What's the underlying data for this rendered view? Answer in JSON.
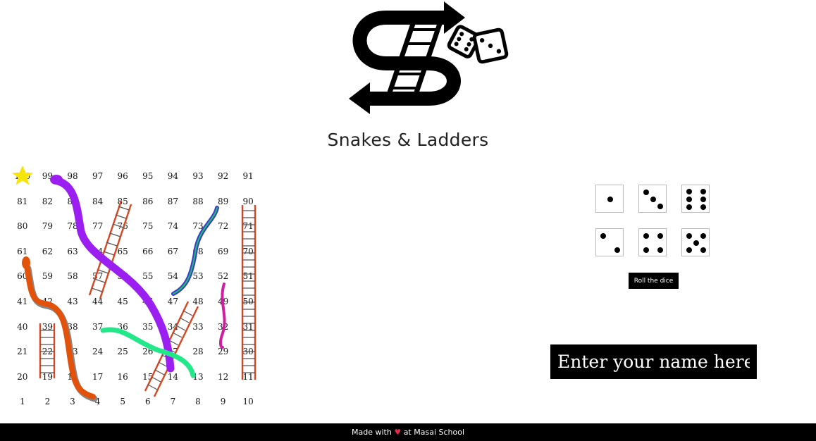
{
  "header": {
    "title": "Snakes & Ladders"
  },
  "board": {
    "rows": [
      [
        100,
        99,
        98,
        97,
        96,
        95,
        94,
        93,
        92,
        91
      ],
      [
        81,
        82,
        83,
        84,
        85,
        86,
        87,
        88,
        89,
        90
      ],
      [
        80,
        79,
        78,
        77,
        76,
        75,
        74,
        73,
        72,
        71
      ],
      [
        61,
        62,
        63,
        64,
        65,
        66,
        67,
        68,
        69,
        70
      ],
      [
        60,
        59,
        58,
        57,
        56,
        55,
        54,
        53,
        52,
        51
      ],
      [
        41,
        42,
        43,
        44,
        45,
        46,
        47,
        48,
        49,
        50
      ],
      [
        40,
        39,
        38,
        37,
        36,
        35,
        34,
        33,
        32,
        31
      ],
      [
        21,
        22,
        23,
        24,
        25,
        26,
        27,
        28,
        29,
        30
      ],
      [
        20,
        19,
        18,
        17,
        16,
        15,
        14,
        13,
        12,
        11
      ],
      [
        1,
        2,
        3,
        4,
        5,
        6,
        7,
        8,
        9,
        10
      ]
    ],
    "star_color": "#f5e50a",
    "ladder_color": "#d9451f",
    "snakes": [
      {
        "name": "purple-snake",
        "color": "#9b1ff0"
      },
      {
        "name": "orange-snake",
        "color": "#e2520a"
      },
      {
        "name": "blue-snake",
        "color": "#3a3ad8"
      },
      {
        "name": "green-snake",
        "color": "#22e88a"
      },
      {
        "name": "magenta-snake",
        "color": "#cf1fa0"
      }
    ]
  },
  "dice": {
    "faces": [
      1,
      3,
      6,
      2,
      4,
      5
    ],
    "roll_label": "Roll the dice"
  },
  "player": {
    "name_placeholder": "Enter your name here"
  },
  "footer": {
    "prefix": "Made with",
    "heart": "♥",
    "suffix": "at Masai School"
  }
}
